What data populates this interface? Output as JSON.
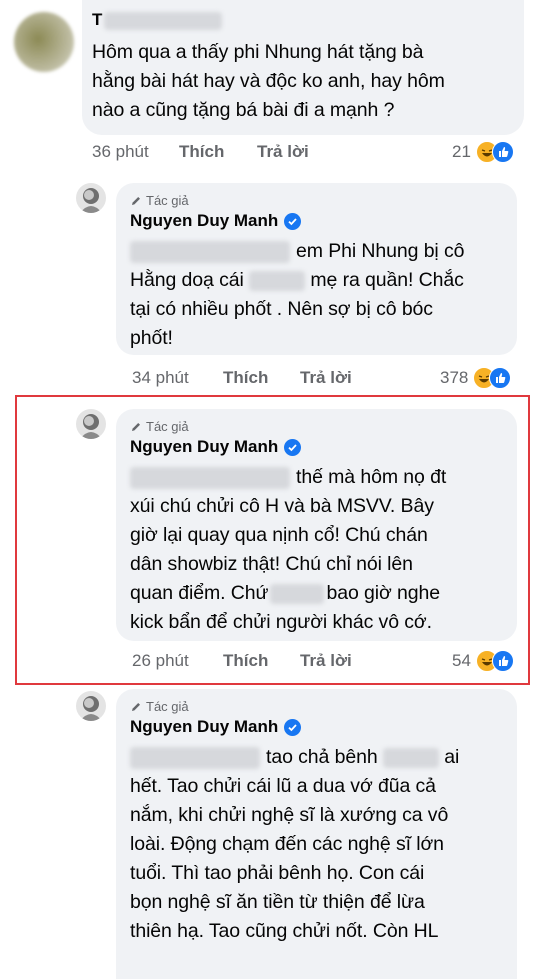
{
  "comment1": {
    "name_blurred": "T",
    "text_lines": [
      "Hôm qua a thấy phi Nhung hát tặng bà",
      "hằng bài hát hay và độc ko anh, hay hôm",
      "nào a cũng tặng bá bài đi a mạnh ?"
    ],
    "time": "36 phút",
    "like_label": "Thích",
    "reply_label": "Trả lời",
    "reaction_count": "21"
  },
  "reply1": {
    "author_tag": "Tác giả",
    "name": "Nguyen Duy Manh",
    "text_line1_tail": "em Phi Nhung bị cô",
    "text_line2_head": "Hằng doạ cái",
    "text_line2_tail": "mẹ ra quần! Chắc",
    "text_lines_rest": [
      "tại có nhiều phốt . Nên sợ bị cô bóc",
      "phốt!"
    ],
    "time": "34 phút",
    "like_label": "Thích",
    "reply_label": "Trả lời",
    "reaction_count": "378"
  },
  "reply2": {
    "author_tag": "Tác giả",
    "name": "Nguyen Duy Manh",
    "text_line1_tail": "thế mà hôm nọ đt",
    "text_lines_mid": [
      "xúi chú chửi cô H và bà MSVV. Bây",
      "giờ lại quay qua nịnh cổ! Chú chán",
      "dân showbiz thật! Chú chỉ nói lên"
    ],
    "text_line5_head": "quan điểm. Chứ",
    "text_line5_tail": "bao giờ nghe",
    "text_line6": "kick bẩn để chửi người khác vô cớ.",
    "time": "26 phút",
    "like_label": "Thích",
    "reply_label": "Trả lời",
    "reaction_count": "54"
  },
  "reply3": {
    "author_tag": "Tác giả",
    "name": "Nguyen Duy Manh",
    "text_line1_mid": "tao chả bênh",
    "text_line1_tail": "ai",
    "text_lines_rest": [
      "hết. Tao chửi cái lũ a dua vớ đũa cả",
      "nắm, khi chửi nghệ sĩ là xướng ca vô",
      "loài. Động chạm đến các nghệ sĩ lớn",
      "tuổi. Thì tao phải bênh họ. Con cái",
      "bọn nghệ sĩ ăn tiền từ thiện để lừa",
      "thiên hạ. Tao cũng chửi nốt. Còn HL"
    ]
  },
  "colors": {
    "bubble": "#f0f2f5",
    "meta": "#65676b",
    "verified": "#1877f2",
    "highlight": "#e0393e",
    "haha": "#f7b125",
    "like": "#1877f2"
  },
  "icons": [
    "pencil-icon",
    "verified-badge-icon",
    "haha-reaction-icon",
    "like-reaction-icon"
  ]
}
